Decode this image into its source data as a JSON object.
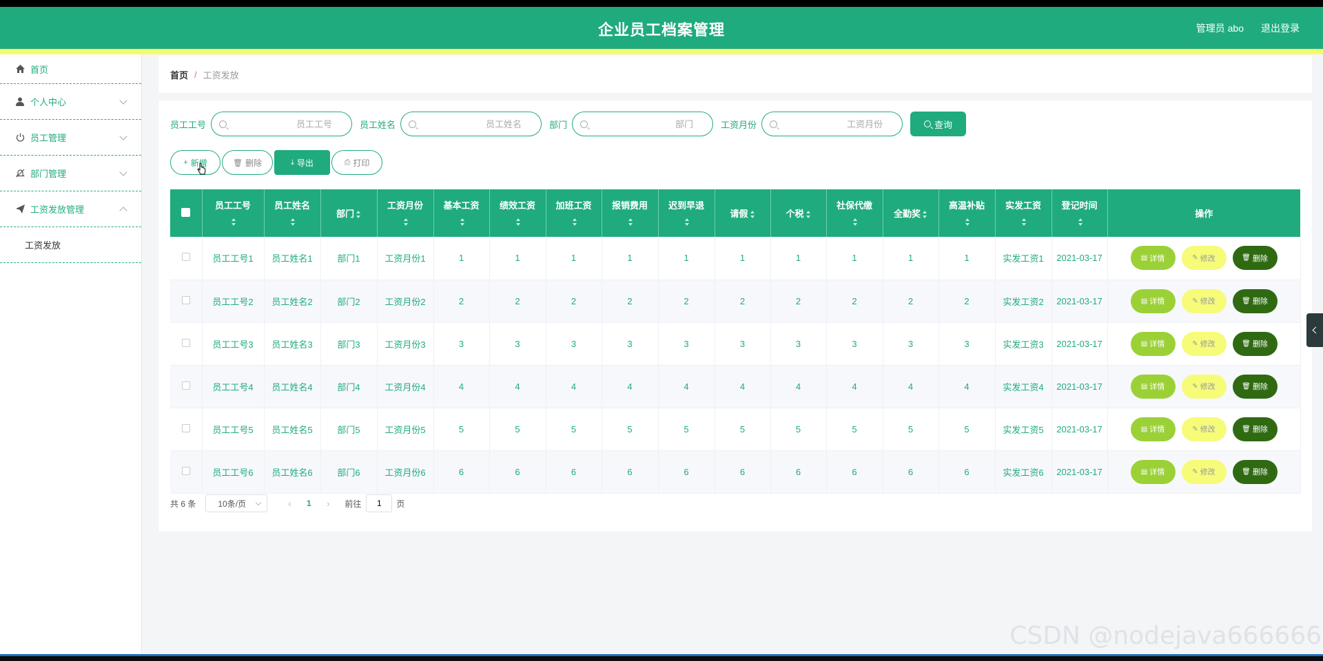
{
  "header": {
    "title": "企业员工档案管理",
    "admin_label": "管理员 abo",
    "logout_label": "退出登录",
    "brand_color": "#1fab7d",
    "stripe_color": "#f4fb6e"
  },
  "sidebar": {
    "items": [
      {
        "label": "首页",
        "icon": "home-icon"
      },
      {
        "label": "个人中心",
        "icon": "user-icon"
      },
      {
        "label": "员工管理",
        "icon": "power-icon"
      },
      {
        "label": "部门管理",
        "icon": "bell-icon"
      },
      {
        "label": "工资发放管理",
        "icon": "send-icon"
      }
    ],
    "submenu": [
      {
        "label": "工资发放"
      }
    ]
  },
  "breadcrumb": {
    "home": "首页",
    "separator": "/",
    "current": "工资发放"
  },
  "search": {
    "fields": [
      {
        "label": "员工工号",
        "placeholder": "员工工号"
      },
      {
        "label": "员工姓名",
        "placeholder": "员工姓名"
      },
      {
        "label": "部门",
        "placeholder": "部门"
      },
      {
        "label": "工资月份",
        "placeholder": "工资月份"
      }
    ],
    "query_label": "查询"
  },
  "actions": {
    "add": "新增",
    "delete": "删除",
    "export": "导出",
    "print": "打印"
  },
  "table": {
    "columns": [
      "员工工号",
      "员工姓名",
      "部门",
      "工资月份",
      "基本工资",
      "绩效工资",
      "加班工资",
      "报销费用",
      "迟到早退",
      "请假",
      "个税",
      "社保代缴",
      "全勤奖",
      "高温补贴",
      "实发工资",
      "登记时间",
      "操作"
    ],
    "rows": [
      [
        "员工工号1",
        "员工姓名1",
        "部门1",
        "工资月份1",
        "1",
        "1",
        "1",
        "1",
        "1",
        "1",
        "1",
        "1",
        "1",
        "1",
        "实发工资1",
        "2021-03-17"
      ],
      [
        "员工工号2",
        "员工姓名2",
        "部门2",
        "工资月份2",
        "2",
        "2",
        "2",
        "2",
        "2",
        "2",
        "2",
        "2",
        "2",
        "2",
        "实发工资2",
        "2021-03-17"
      ],
      [
        "员工工号3",
        "员工姓名3",
        "部门3",
        "工资月份3",
        "3",
        "3",
        "3",
        "3",
        "3",
        "3",
        "3",
        "3",
        "3",
        "3",
        "实发工资3",
        "2021-03-17"
      ],
      [
        "员工工号4",
        "员工姓名4",
        "部门4",
        "工资月份4",
        "4",
        "4",
        "4",
        "4",
        "4",
        "4",
        "4",
        "4",
        "4",
        "4",
        "实发工资4",
        "2021-03-17"
      ],
      [
        "员工工号5",
        "员工姓名5",
        "部门5",
        "工资月份5",
        "5",
        "5",
        "5",
        "5",
        "5",
        "5",
        "5",
        "5",
        "5",
        "5",
        "实发工资5",
        "2021-03-17"
      ],
      [
        "员工工号6",
        "员工姓名6",
        "部门6",
        "工资月份6",
        "6",
        "6",
        "6",
        "6",
        "6",
        "6",
        "6",
        "6",
        "6",
        "6",
        "实发工资6",
        "2021-03-17"
      ]
    ],
    "row_actions": {
      "detail": "详情",
      "edit": "修改",
      "delete": "删除"
    }
  },
  "pagination": {
    "total": "共 6 条",
    "page_size": "10条/页",
    "current_page": "1",
    "goto_label": "前往",
    "goto_value": "1",
    "page_suffix": "页"
  },
  "watermark": "CSDN @nodejava666666"
}
